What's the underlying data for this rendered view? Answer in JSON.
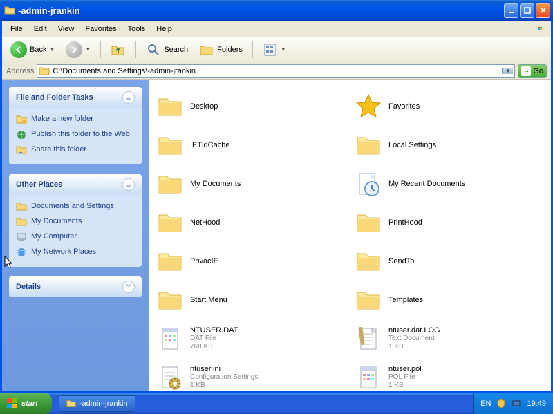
{
  "window": {
    "title": "-admin-jrankin",
    "address_label": "Address",
    "path": "C:\\Documents and Settings\\-admin-jrankin",
    "go": "Go"
  },
  "menu": {
    "file": "File",
    "edit": "Edit",
    "view": "View",
    "favorites": "Favorites",
    "tools": "Tools",
    "help": "Help"
  },
  "toolbar": {
    "back": "Back",
    "search": "Search",
    "folders": "Folders"
  },
  "side": {
    "panel1": {
      "title": "File and Folder Tasks",
      "items": [
        "Make a new folder",
        "Publish this folder to the Web",
        "Share this folder"
      ]
    },
    "panel2": {
      "title": "Other Places",
      "items": [
        "Documents and Settings",
        "My Documents",
        "My Computer",
        "My Network Places"
      ]
    },
    "panel3": {
      "title": "Details"
    }
  },
  "files": [
    {
      "name": "Desktop",
      "type": "folder"
    },
    {
      "name": "Favorites",
      "type": "star"
    },
    {
      "name": "IETldCache",
      "type": "folder"
    },
    {
      "name": "Local Settings",
      "type": "folder"
    },
    {
      "name": "My Documents",
      "type": "folder"
    },
    {
      "name": "My Recent Documents",
      "type": "recent"
    },
    {
      "name": "NetHood",
      "type": "folder"
    },
    {
      "name": "PrintHood",
      "type": "folder"
    },
    {
      "name": "PrivacIE",
      "type": "folder"
    },
    {
      "name": "SendTo",
      "type": "folder"
    },
    {
      "name": "Start Menu",
      "type": "folder"
    },
    {
      "name": "Templates",
      "type": "folder"
    },
    {
      "name": "NTUSER.DAT",
      "type": "dat",
      "meta1": "DAT File",
      "meta2": "768 KB"
    },
    {
      "name": "ntuser.dat.LOG",
      "type": "txt",
      "meta1": "Text Document",
      "meta2": "1 KB"
    },
    {
      "name": "ntuser.ini",
      "type": "ini",
      "meta1": "Configuration Settings",
      "meta2": "1 KB"
    },
    {
      "name": "ntuser.pol",
      "type": "pol",
      "meta1": "POL File",
      "meta2": "1 KB"
    }
  ],
  "taskbar": {
    "start": "start",
    "task": "-admin-jrankin",
    "lang": "EN",
    "time": "19:49"
  }
}
